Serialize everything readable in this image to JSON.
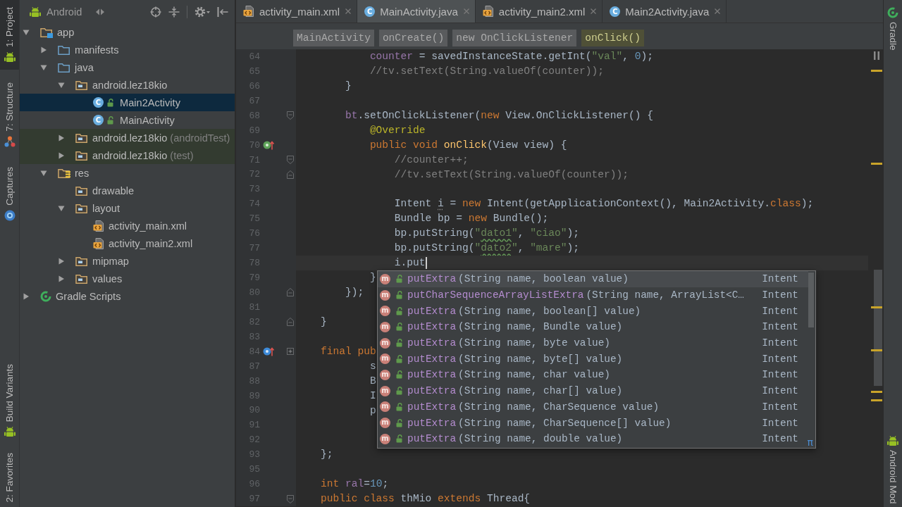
{
  "tool_windows_left": {
    "top": [
      {
        "label": "1: Project",
        "kind": "android",
        "selected": true
      },
      {
        "label": "7: Structure",
        "kind": "structure",
        "selected": false
      },
      {
        "label": "Captures",
        "kind": "captures",
        "selected": false
      }
    ],
    "bottom": [
      {
        "label": "Build Variants",
        "kind": "android",
        "selected": false
      },
      {
        "label": "2: Favorites",
        "selected": false
      }
    ]
  },
  "project_panel": {
    "view": "Android",
    "tree": [
      {
        "label": "app",
        "kind": "module",
        "expanded": true,
        "selected": false,
        "children": [
          {
            "label": "manifests",
            "kind": "source-folder",
            "expanded": false,
            "selected": false
          },
          {
            "label": "java",
            "kind": "source-folder",
            "expanded": true,
            "selected": false,
            "children": [
              {
                "label": "android.lez18kio",
                "kind": "package",
                "expanded": true,
                "selected": false,
                "children": [
                  {
                    "label": "Main2Activity",
                    "kind": "class",
                    "letter": "C",
                    "selected": true
                  },
                  {
                    "label": "MainActivity",
                    "kind": "class",
                    "letter": "C",
                    "selected": false
                  }
                ]
              },
              {
                "label": "android.lez18kio",
                "note": "(androidTest)",
                "kind": "test-package",
                "expanded": false,
                "selected": false
              },
              {
                "label": "android.lez18kio",
                "note": "(test)",
                "kind": "test-package",
                "expanded": false,
                "selected": false
              }
            ]
          },
          {
            "label": "res",
            "kind": "resources",
            "expanded": true,
            "selected": false,
            "children": [
              {
                "label": "drawable",
                "kind": "folder",
                "selected": false
              },
              {
                "label": "layout",
                "kind": "folder",
                "expanded": true,
                "selected": false,
                "children": [
                  {
                    "label": "activity_main.xml",
                    "kind": "xml-file",
                    "selected": false
                  },
                  {
                    "label": "activity_main2.xml",
                    "kind": "xml-file",
                    "selected": false
                  }
                ]
              },
              {
                "label": "mipmap",
                "kind": "folder",
                "expanded": false,
                "selected": false
              },
              {
                "label": "values",
                "kind": "folder",
                "expanded": false,
                "selected": false
              }
            ]
          }
        ]
      },
      {
        "label": "Gradle Scripts",
        "kind": "gradle",
        "expanded": false,
        "selected": false
      }
    ]
  },
  "tabs": [
    {
      "label": "activity_main.xml",
      "kind": "xml",
      "selected": false
    },
    {
      "label": "MainActivity.java",
      "kind": "class",
      "letter": "C",
      "selected": true
    },
    {
      "label": "activity_main2.xml",
      "kind": "xml",
      "selected": false
    },
    {
      "label": "Main2Activity.java",
      "kind": "class",
      "letter": "C",
      "selected": false
    }
  ],
  "breadcrumbs": [
    {
      "label": "MainActivity",
      "selected": false
    },
    {
      "label": "onCreate()",
      "selected": false
    },
    {
      "label": "new OnClickListener",
      "selected": false
    },
    {
      "label": "onClick()",
      "selected": true
    }
  ],
  "editor": {
    "lines": [
      {
        "number": "64",
        "tokens": [
          {
            "kind": "field",
            "text": "            counter"
          },
          {
            "kind": "plain",
            "text": " = savedInstanceState.getInt("
          },
          {
            "kind": "string",
            "text": "\"val\""
          },
          {
            "kind": "plain",
            "text": ", "
          },
          {
            "kind": "number",
            "text": "0"
          },
          {
            "kind": "plain",
            "text": ");"
          }
        ]
      },
      {
        "number": "65",
        "tokens": [
          {
            "kind": "comment",
            "text": "            //tv.setText(String.valueOf(counter));"
          }
        ]
      },
      {
        "number": "66",
        "tokens": [
          {
            "kind": "plain",
            "text": "        }"
          }
        ]
      },
      {
        "number": "67"
      },
      {
        "number": "68",
        "markers": [
          {
            "kind": "fold-start"
          }
        ],
        "tokens": [
          {
            "kind": "field",
            "text": "        bt"
          },
          {
            "kind": "plain",
            "text": ".setOnClickListener("
          },
          {
            "kind": "keyword",
            "text": "new"
          },
          {
            "kind": "plain",
            "text": " View.OnClickListener() {"
          }
        ]
      },
      {
        "number": "69",
        "tokens": [
          {
            "kind": "annotation",
            "text": "            @Override"
          }
        ]
      },
      {
        "number": "70",
        "markers": [
          {
            "kind": "override"
          }
        ],
        "tokens": [
          {
            "kind": "keyword",
            "text": "            public void "
          },
          {
            "kind": "method",
            "text": "onClick"
          },
          {
            "kind": "plain",
            "text": "(View view) {"
          }
        ]
      },
      {
        "number": "71",
        "markers": [
          {
            "kind": "fold-start"
          }
        ],
        "tokens": [
          {
            "kind": "comment",
            "text": "                //counter++;"
          }
        ]
      },
      {
        "number": "72",
        "markers": [
          {
            "kind": "fold-end"
          }
        ],
        "tokens": [
          {
            "kind": "comment",
            "text": "                //tv.setText(String.valueOf(counter));"
          }
        ]
      },
      {
        "number": "73"
      },
      {
        "number": "74",
        "tokens": [
          {
            "kind": "plain",
            "text": "                Intent "
          },
          {
            "kind": "warn",
            "text": "i"
          },
          {
            "kind": "plain",
            "text": " = "
          },
          {
            "kind": "keyword",
            "text": "new"
          },
          {
            "kind": "plain",
            "text": " Intent(getApplicationContext(), Main2Activity."
          },
          {
            "kind": "keyword",
            "text": "class"
          },
          {
            "kind": "plain",
            "text": ");"
          }
        ]
      },
      {
        "number": "75",
        "tokens": [
          {
            "kind": "plain",
            "text": "                Bundle bp = "
          },
          {
            "kind": "keyword",
            "text": "new"
          },
          {
            "kind": "plain",
            "text": " Bundle();"
          }
        ]
      },
      {
        "number": "76",
        "tokens": [
          {
            "kind": "plain",
            "text": "                bp.putString("
          },
          {
            "kind": "string",
            "text": "\""
          },
          {
            "kind": "typo",
            "text": "dato1"
          },
          {
            "kind": "string",
            "text": "\""
          },
          {
            "kind": "plain",
            "text": ", "
          },
          {
            "kind": "string",
            "text": "\"ciao\""
          },
          {
            "kind": "plain",
            "text": ");"
          }
        ]
      },
      {
        "number": "77",
        "tokens": [
          {
            "kind": "plain",
            "text": "                bp.putString("
          },
          {
            "kind": "string",
            "text": "\""
          },
          {
            "kind": "typo",
            "text": "dato2"
          },
          {
            "kind": "string",
            "text": "\""
          },
          {
            "kind": "plain",
            "text": ", "
          },
          {
            "kind": "string",
            "text": "\"mare\""
          },
          {
            "kind": "plain",
            "text": ");"
          }
        ]
      },
      {
        "number": "78",
        "tokens": [
          {
            "kind": "plain",
            "text": "                i.put"
          },
          {
            "kind": "caret"
          }
        ]
      },
      {
        "number": "79",
        "tokens": [
          {
            "kind": "plain",
            "text": "            }"
          }
        ]
      },
      {
        "number": "80",
        "markers": [
          {
            "kind": "fold-end"
          }
        ],
        "tokens": [
          {
            "kind": "plain",
            "text": "        });"
          }
        ]
      },
      {
        "number": "81"
      },
      {
        "number": "82",
        "markers": [
          {
            "kind": "fold-end"
          }
        ],
        "tokens": [
          {
            "kind": "plain",
            "text": "    }"
          }
        ]
      },
      {
        "number": "83"
      },
      {
        "number": "84",
        "markers": [
          {
            "kind": "implement"
          },
          {
            "kind": "fold-collapsed"
          }
        ],
        "tokens": [
          {
            "kind": "keyword",
            "text": "    final pub"
          }
        ]
      },
      {
        "number": "87",
        "tokens": [
          {
            "kind": "plain",
            "text": "            s"
          }
        ]
      },
      {
        "number": "88",
        "tokens": [
          {
            "kind": "plain",
            "text": "            B"
          }
        ]
      },
      {
        "number": "89",
        "tokens": [
          {
            "kind": "plain",
            "text": "            I"
          }
        ]
      },
      {
        "number": "90",
        "tokens": [
          {
            "kind": "plain",
            "text": "            p"
          }
        ]
      },
      {
        "number": "91"
      },
      {
        "number": "92"
      },
      {
        "number": "93",
        "tokens": [
          {
            "kind": "plain",
            "text": "    };"
          }
        ]
      },
      {
        "number": "95"
      },
      {
        "number": "96",
        "tokens": [
          {
            "kind": "keyword",
            "text": "    int "
          },
          {
            "kind": "field",
            "text": "ral"
          },
          {
            "kind": "plain",
            "text": "="
          },
          {
            "kind": "number",
            "text": "10"
          },
          {
            "kind": "plain",
            "text": ";"
          }
        ]
      },
      {
        "number": "97",
        "markers": [
          {
            "kind": "fold-start"
          }
        ],
        "tokens": [
          {
            "kind": "keyword",
            "text": "    public class "
          },
          {
            "kind": "plain",
            "text": "thMio "
          },
          {
            "kind": "keyword",
            "text": "extends "
          },
          {
            "kind": "plain",
            "text": "Thread{"
          }
        ]
      }
    ]
  },
  "completion": {
    "items": [
      {
        "letter": "m",
        "name": "putExtra",
        "params": "(String name, boolean value)",
        "type": "Intent",
        "selected": true
      },
      {
        "letter": "m",
        "name": "putCharSequenceArrayListExtra",
        "params": "(String name, ArrayList<C…",
        "type": "Intent",
        "selected": false
      },
      {
        "letter": "m",
        "name": "putExtra",
        "params": "(String name, boolean[] value)",
        "type": "Intent",
        "selected": false
      },
      {
        "letter": "m",
        "name": "putExtra",
        "params": "(String name, Bundle value)",
        "type": "Intent",
        "selected": false
      },
      {
        "letter": "m",
        "name": "putExtra",
        "params": "(String name, byte value)",
        "type": "Intent",
        "selected": false
      },
      {
        "letter": "m",
        "name": "putExtra",
        "params": "(String name, byte[] value)",
        "type": "Intent",
        "selected": false
      },
      {
        "letter": "m",
        "name": "putExtra",
        "params": "(String name, char value)",
        "type": "Intent",
        "selected": false
      },
      {
        "letter": "m",
        "name": "putExtra",
        "params": "(String name, char[] value)",
        "type": "Intent",
        "selected": false
      },
      {
        "letter": "m",
        "name": "putExtra",
        "params": "(String name, CharSequence value)",
        "type": "Intent",
        "selected": false
      },
      {
        "letter": "m",
        "name": "putExtra",
        "params": "(String name, CharSequence[] value)",
        "type": "Intent",
        "selected": false
      },
      {
        "letter": "m",
        "name": "putExtra",
        "params": "(String name, double value)",
        "type": "Intent",
        "selected": false
      }
    ],
    "hint": "π"
  },
  "tool_windows_right": {
    "top": [
      {
        "label": "Gradle",
        "kind": "gradle"
      }
    ],
    "bottom": [
      {
        "label": "Android Mod",
        "kind": "android"
      }
    ]
  }
}
